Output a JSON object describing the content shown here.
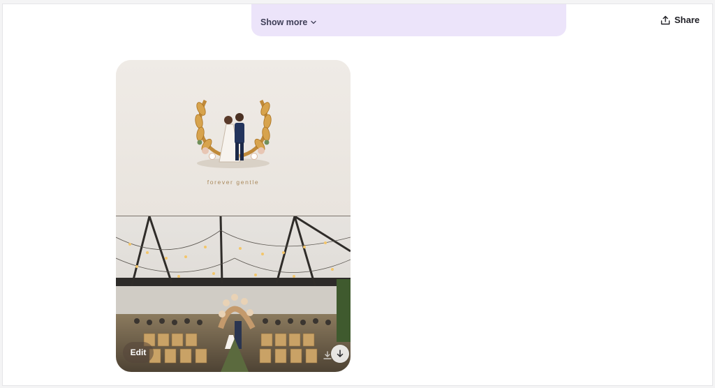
{
  "banner": {
    "show_more_label": "Show more"
  },
  "header": {
    "share_label": "Share"
  },
  "card": {
    "caption": "forever gentle",
    "edit_label": "Edit"
  },
  "icons": {
    "chevron": "chevron-down-icon",
    "share": "share-icon",
    "download": "download-icon"
  },
  "colors": {
    "banner": "#ece4fa",
    "caption": "#a9885c"
  }
}
